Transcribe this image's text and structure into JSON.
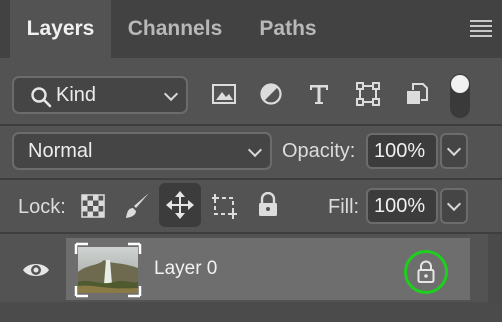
{
  "tabs": [
    {
      "label": "Layers",
      "active": true
    },
    {
      "label": "Channels",
      "active": false
    },
    {
      "label": "Paths",
      "active": false
    }
  ],
  "filter": {
    "kind_label": "Kind",
    "icons": [
      "pixel-layer-filter-icon",
      "adjustment-layer-filter-icon",
      "type-layer-filter-icon",
      "shape-layer-filter-icon",
      "smart-object-filter-icon",
      "filter-toggle-icon"
    ]
  },
  "blend": {
    "mode": "Normal",
    "opacity_label": "Opacity:",
    "opacity_value": "100%"
  },
  "lock": {
    "label": "Lock:",
    "icons": [
      "lock-transparent-pixels-icon",
      "lock-image-pixels-icon",
      "lock-position-icon",
      "lock-artboard-icon",
      "lock-all-icon"
    ],
    "fill_label": "Fill:",
    "fill_value": "100%"
  },
  "layers": [
    {
      "name": "Layer 0",
      "visible": true,
      "locked": true
    }
  ],
  "colors": {
    "panel_bg": "#535353",
    "tabbar_bg": "#424242",
    "selected_layer_bg": "#6e6e6e",
    "lock_highlight": "#1fcf1f"
  }
}
